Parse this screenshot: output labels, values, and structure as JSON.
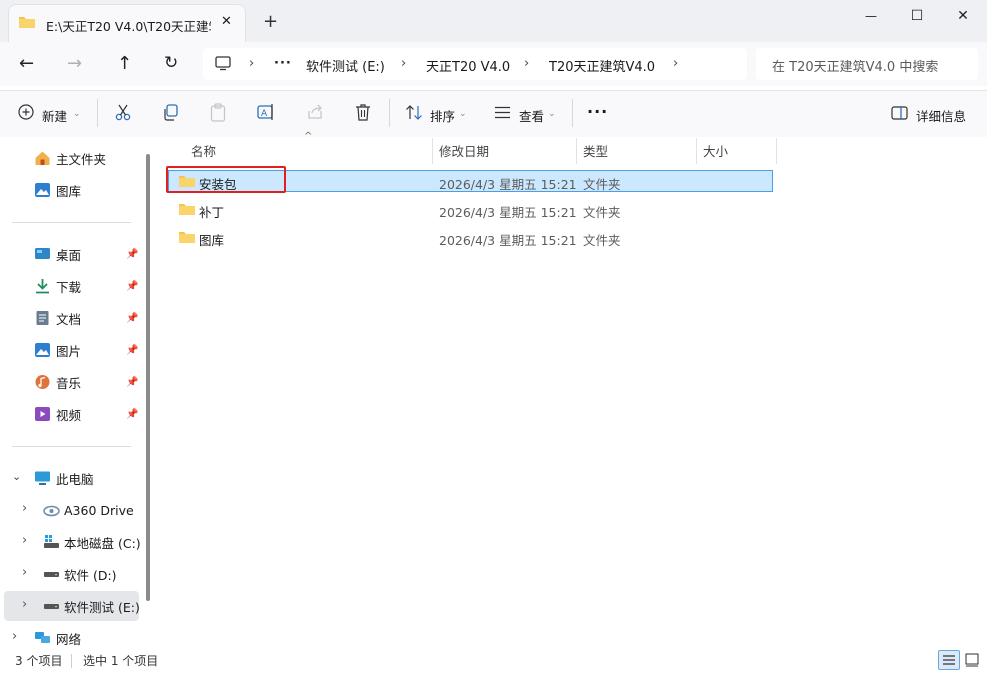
{
  "window": {
    "tab_title": "E:\\天正T20 V4.0\\T20天正建筑V",
    "new_tab": "+",
    "minimize": "—",
    "maximize": "☐",
    "close": "✕"
  },
  "nav": {
    "back": "←",
    "forward": "→",
    "up": "↑",
    "refresh": "↻",
    "ellipsis": "···",
    "breadcrumb": [
      "软件测试 (E:)",
      "天正T20 V4.0",
      "T20天正建筑V4.0"
    ],
    "search_placeholder": "在 T20天正建筑V4.0 中搜索"
  },
  "toolbar": {
    "new_label": "新建",
    "sort_label": "排序",
    "view_label": "查看",
    "more": "···",
    "details_label": "详细信息"
  },
  "sidebar": {
    "quick": [
      {
        "label": "主文件夹",
        "icon": "home-icon"
      },
      {
        "label": "图库",
        "icon": "gallery-icon"
      }
    ],
    "pinned": [
      {
        "label": "桌面",
        "icon": "desktop-icon"
      },
      {
        "label": "下载",
        "icon": "download-icon"
      },
      {
        "label": "文档",
        "icon": "document-icon"
      },
      {
        "label": "图片",
        "icon": "pictures-icon"
      },
      {
        "label": "音乐",
        "icon": "music-icon"
      },
      {
        "label": "视频",
        "icon": "video-icon"
      }
    ],
    "this_pc": "此电脑",
    "drives": [
      {
        "label": "A360 Drive"
      },
      {
        "label": "本地磁盘 (C:)"
      },
      {
        "label": "软件 (D:)"
      },
      {
        "label": "软件测试 (E:)"
      }
    ],
    "network": "网络"
  },
  "columns": {
    "name": "名称",
    "modified": "修改日期",
    "type": "类型",
    "size": "大小"
  },
  "files": [
    {
      "name": "安装包",
      "modified": "2026/4/3 星期五 15:21",
      "type": "文件夹",
      "size": ""
    },
    {
      "name": "补丁",
      "modified": "2026/4/3 星期五 15:21",
      "type": "文件夹",
      "size": ""
    },
    {
      "name": "图库",
      "modified": "2026/4/3 星期五 15:21",
      "type": "文件夹",
      "size": ""
    }
  ],
  "status": {
    "count": "3 个项目",
    "selected": "选中 1 个项目"
  },
  "colors": {
    "selection": "#cce8ff",
    "selection_border": "#4a9fe8",
    "annotation": "#e0201f",
    "folder": "#f4c34d"
  }
}
